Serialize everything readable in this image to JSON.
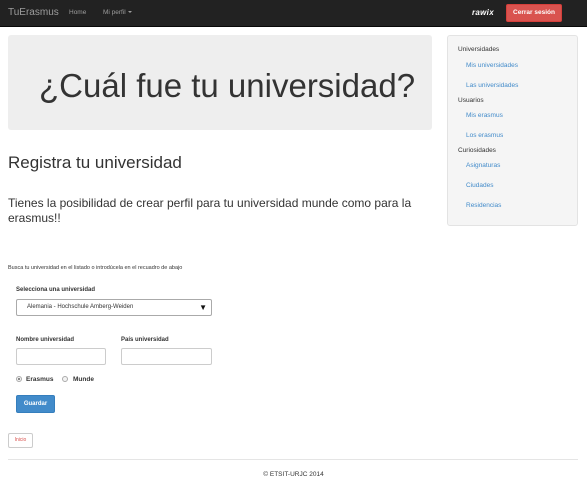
{
  "navbar": {
    "brand": "TuErasmus",
    "home": "Home",
    "profile": "Mi perfil",
    "logo": "rawix",
    "logout": "Cerrar sesión"
  },
  "jumbotron": {
    "title": "¿Cuál fue tu universidad?"
  },
  "main": {
    "section_title": "Registra tu universidad",
    "lead": "Tienes la posibilidad de crear perfil para tu universidad munde como para la erasmus!!",
    "hint": "Busca tu universidad en el listado o introdúcela en el recuadro de abajo",
    "select_label": "Selecciona una universidad",
    "select_value": "Alemania - Hochschule Amberg-Weiden",
    "name_label": "Nombre universidad",
    "name_value": "",
    "country_label": "País universidad",
    "country_value": "",
    "radio_erasmus": "Erasmus",
    "radio_munde": "Munde",
    "save": "Guardar",
    "home_button": "Inicio"
  },
  "sidebar": {
    "groups": [
      {
        "header": "Universidades",
        "links": [
          "Mis universidades",
          "Las universidades"
        ]
      },
      {
        "header": "Usuarios",
        "links": [
          "Mis erasmus",
          "Los erasmus"
        ]
      },
      {
        "header": "Curiosidades",
        "links": [
          "Asignaturas",
          "Ciudades",
          "Residencias"
        ]
      }
    ]
  },
  "footer": "© ETSIT-URJC 2014",
  "colors": {
    "navbar_bg": "#222222",
    "danger": "#d9534f",
    "primary": "#428bca",
    "jumbotron_bg": "#eeeeee",
    "sidebar_bg": "#f5f5f5"
  }
}
